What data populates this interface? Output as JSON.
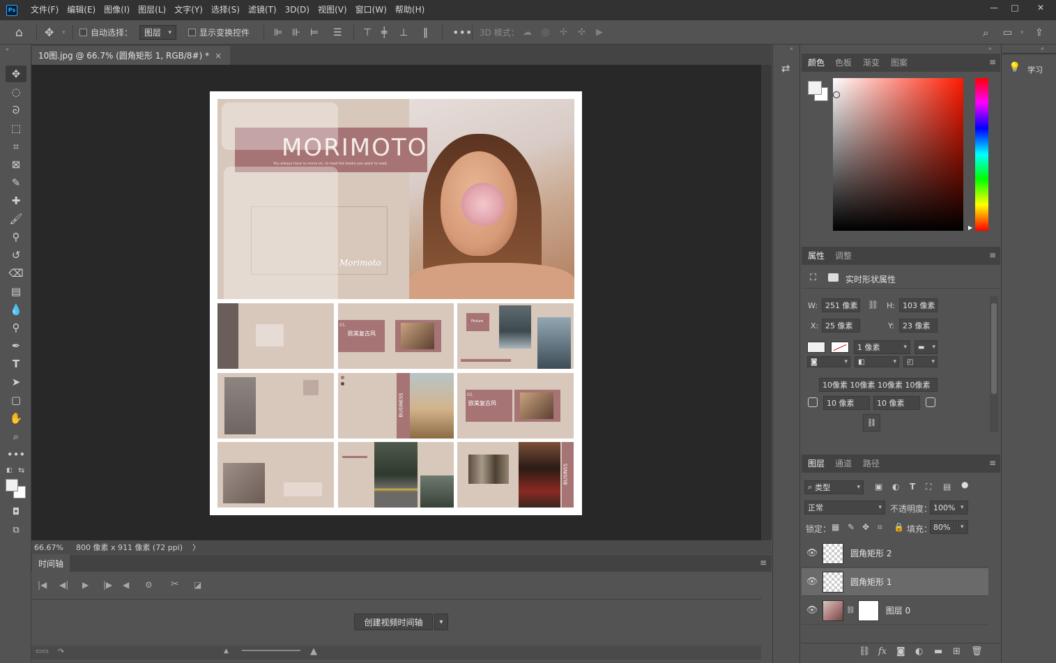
{
  "menu": [
    "文件(F)",
    "编辑(E)",
    "图像(I)",
    "图层(L)",
    "文字(Y)",
    "选择(S)",
    "滤镜(T)",
    "3D(D)",
    "视图(V)",
    "窗口(W)",
    "帮助(H)"
  ],
  "app_logo": "Ps",
  "window_controls": {
    "minimize": "—",
    "maximize": "□",
    "close": "✕"
  },
  "options": {
    "auto_select_label": "自动选择：",
    "auto_select_target": "图层",
    "show_transform_label": "显示变换控件",
    "mode_3d_label": "3D 模式："
  },
  "document": {
    "tab_title": "10图.jpg @ 66.7% (圆角矩形 1, RGB/8#) *",
    "close_glyph": "×",
    "hero_title": "MORIMOTO",
    "hero_subtitle": "You always have to move on, to read the books you want to read.",
    "signature": "Morimoto",
    "thumb_label_1": "欧美复古风",
    "thumb_label_2": "欧美复古风",
    "thumb_label_business_1": "BUSINESS",
    "thumb_label_business_2": "BUSINSS",
    "thumb_label_picture": "Picture",
    "thumb_num_1": "01.",
    "thumb_num_2": "02."
  },
  "status": {
    "zoom": "66.67%",
    "info": "800 像素 x 911 像素 (72 ppi)",
    "arrow": "〉"
  },
  "timeline": {
    "tab": "时间轴",
    "create_button": "创建视频时间轴"
  },
  "color_panel": {
    "tabs": [
      "颜色",
      "色板",
      "渐变",
      "图案"
    ]
  },
  "learn_panel": {
    "label": "学习"
  },
  "properties_panel": {
    "tabs": [
      "属性",
      "调整"
    ],
    "header": "实时形状属性",
    "w_label": "W:",
    "w_value": "251 像素",
    "h_label": "H:",
    "h_value": "103 像素",
    "x_label": "X:",
    "x_value": "25 像素",
    "y_label": "Y:",
    "y_value": "23 像素",
    "stroke_width": "1 像素",
    "corner_radii_all": "10像素 10像素 10像素 10像素",
    "corner_tl": "10 像素",
    "corner_tr": "10 像素"
  },
  "layers_panel": {
    "tabs": [
      "图层",
      "通道",
      "路径"
    ],
    "filter_kind": "类型",
    "blend_mode": "正常",
    "opacity_label": "不透明度：",
    "opacity_value": "100%",
    "lock_label": "锁定：",
    "fill_label": "填充：",
    "fill_value": "80%",
    "layers": [
      {
        "name": "圆角矩形 2",
        "selected": false
      },
      {
        "name": "圆角矩形 1",
        "selected": true
      },
      {
        "name": "图层 0",
        "selected": false
      }
    ]
  },
  "colors": {
    "accent_pink": "#a67475",
    "background_beige": "#d8c7bb",
    "canvas_bg": "#282828"
  }
}
